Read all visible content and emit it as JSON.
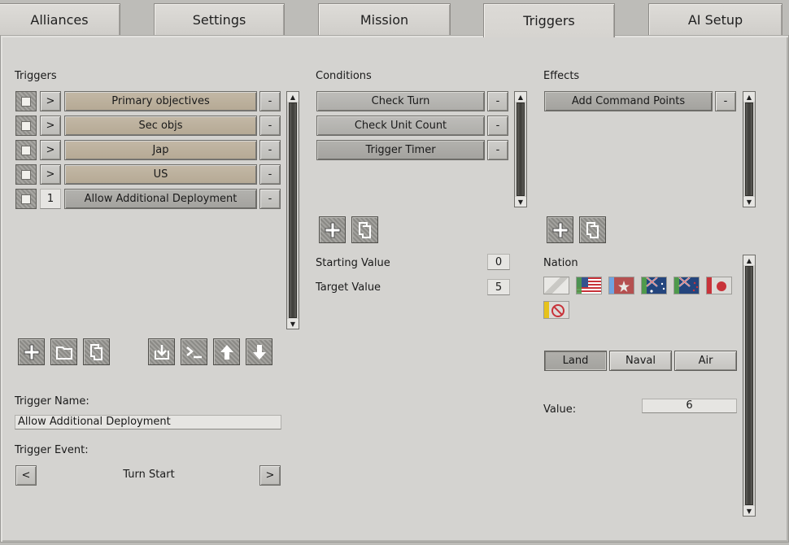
{
  "tabs": [
    {
      "label": "Alliances"
    },
    {
      "label": "Settings"
    },
    {
      "label": "Mission"
    },
    {
      "label": "Triggers",
      "active": true
    },
    {
      "label": "AI Setup"
    }
  ],
  "triggers": {
    "heading": "Triggers",
    "items": [
      {
        "expand": ">",
        "label": "Primary objectives",
        "remove": "-"
      },
      {
        "expand": ">",
        "label": "Sec objs",
        "remove": "-"
      },
      {
        "expand": ">",
        "label": "Jap",
        "remove": "-"
      },
      {
        "expand": ">",
        "label": "US",
        "remove": "-"
      },
      {
        "expand": "1",
        "label": "Allow Additional Deployment",
        "remove": "-"
      }
    ],
    "name_label": "Trigger Name:",
    "name_value": "Allow Additional Deployment",
    "event_label": "Trigger Event:",
    "event_prev": "<",
    "event_value": "Turn Start",
    "event_next": ">"
  },
  "conditions": {
    "heading": "Conditions",
    "items": [
      {
        "label": "Check Turn",
        "remove": "-"
      },
      {
        "label": "Check Unit Count",
        "remove": "-"
      },
      {
        "label": "Trigger Timer",
        "remove": "-"
      }
    ],
    "starting_value_label": "Starting Value",
    "starting_value": "0",
    "target_value_label": "Target Value",
    "target_value": "5"
  },
  "effects": {
    "heading": "Effects",
    "items": [
      {
        "label": "Add Command Points",
        "remove": "-"
      }
    ],
    "nation_label": "Nation",
    "nations": [
      "none-flag",
      "usa-flag",
      "china-flag",
      "australia-flag",
      "new-zealand-flag",
      "japan-flag",
      "none-selected-flag"
    ],
    "domain_buttons": [
      {
        "label": "Land",
        "selected": true
      },
      {
        "label": "Naval",
        "selected": false
      },
      {
        "label": "Air",
        "selected": false
      }
    ],
    "value_label": "Value:",
    "value": "6"
  },
  "colors": {
    "panel": "#d4d3d0",
    "trigger_bar": "#b9ae9b",
    "condition_bar": "#b5b4b0"
  }
}
